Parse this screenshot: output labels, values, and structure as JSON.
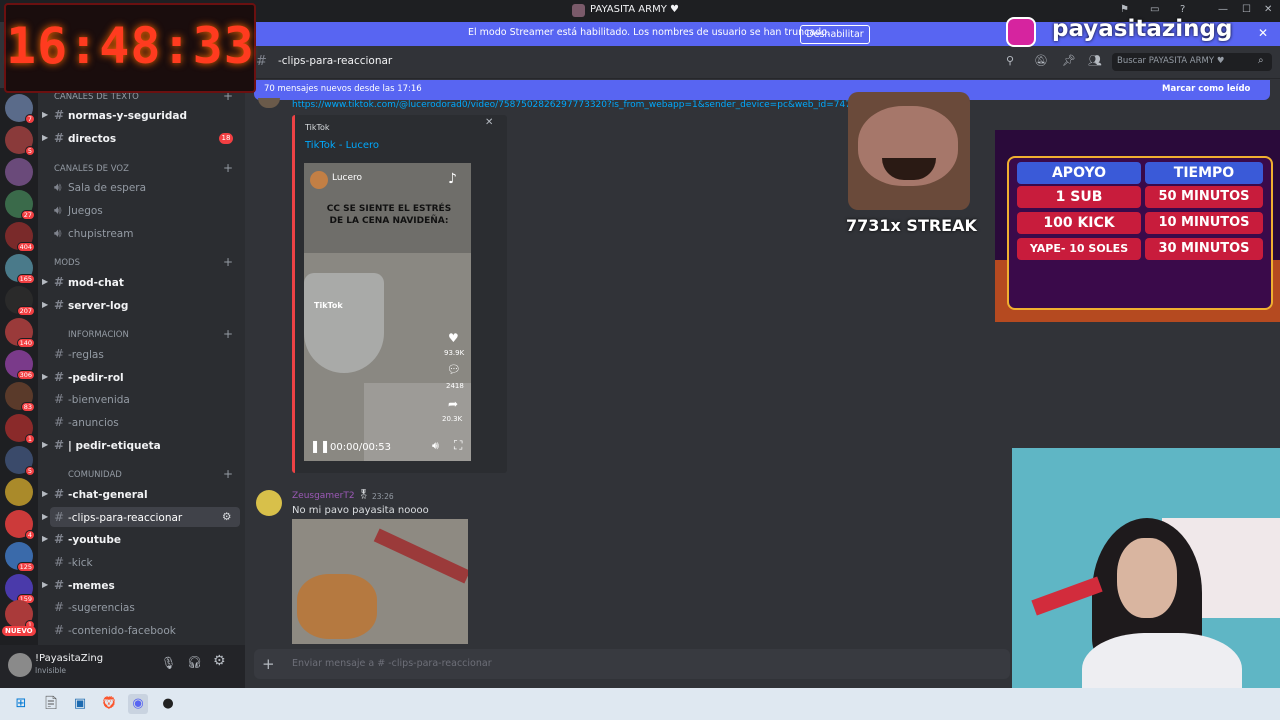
{
  "window": {
    "title": "PAYASITA ARMY ♥"
  },
  "streamer_bar": {
    "message": "El modo Streamer está habilitado. Los nombres de usuario se han truncado.",
    "button": "Deshabilitar"
  },
  "clock": {
    "time": "16:48:33"
  },
  "instagram": {
    "handle": "payasitazingg"
  },
  "channel_header": {
    "name": "-clips-para-reaccionar",
    "search_placeholder": "Buscar PAYASITA ARMY ♥"
  },
  "new_messages": {
    "text": "70 mensajes nuevos desde las 17:16",
    "action": "Marcar como leído"
  },
  "sidebar": {
    "top_channels": [
      {
        "label": "normas-y-seguridad"
      },
      {
        "label": "directos",
        "badge": "18"
      }
    ],
    "categories": {
      "texto": "Canales de texto",
      "voz": "Canales de voz",
      "mods": "MODS",
      "informacion": "INFORMACION",
      "comunidad": "COMUNIDAD"
    },
    "voice_channels": [
      "Sala de espera",
      "Juegos",
      "chupistream"
    ],
    "mods_channels": [
      "mod-chat",
      "server-log"
    ],
    "info_channels": [
      "-reglas",
      "-pedir-rol",
      "-bienvenida",
      "-anuncios",
      "| pedir-etiqueta"
    ],
    "community_channels": [
      "-chat-general",
      "-clips-para-reaccionar",
      "-youtube",
      "-kick",
      "-memes",
      "-sugerencias",
      "-contenido-facebook"
    ]
  },
  "servers": {
    "badges": [
      "7",
      "5",
      "27",
      "404",
      "165",
      "207",
      "140",
      "306",
      "83",
      "1",
      "5",
      "4",
      "125",
      "159",
      "1"
    ],
    "new_label": "NUEVO"
  },
  "user": {
    "name": "!PayasitaZing",
    "status": "Invisible"
  },
  "embed": {
    "link": "https://www.tiktok.com/@lucerodorad0/video/7587502826297773320?is_from_webapp=1&sender_device=pc&web_id=747",
    "provider": "TikTok",
    "title": "TikTok - Lucero",
    "video_author": "Lucero",
    "video_caption": "CC SE SIENTE EL ESTRÉS DE LA CENA NAVIDEÑA:",
    "watermark": "TikTok",
    "likes": "93.9K",
    "comments": "2418",
    "shares": "20.3K",
    "time": "00:00/00:53"
  },
  "message2": {
    "author": "ZeusgamerT2",
    "time": "23:26",
    "text": "No mi pavo payasita noooo"
  },
  "input": {
    "placeholder": "Enviar mensaje a # -clips-para-reaccionar"
  },
  "overlay": {
    "streak": "7731x STREAK"
  },
  "promo": {
    "headers": [
      "APOYO",
      "TIEMPO"
    ],
    "rows": [
      {
        "left": "1 SUB",
        "right": "50 MINUTOS"
      },
      {
        "left": "100 KICK",
        "right": "10 MINUTOS"
      },
      {
        "left": "YAPE- 10 SOLES",
        "right": "30 MINUTOS"
      }
    ]
  },
  "colors": {
    "discord_blurple": "#5865f2",
    "background": "#313338",
    "sidebar": "#2b2d31",
    "red": "#f23f42"
  }
}
